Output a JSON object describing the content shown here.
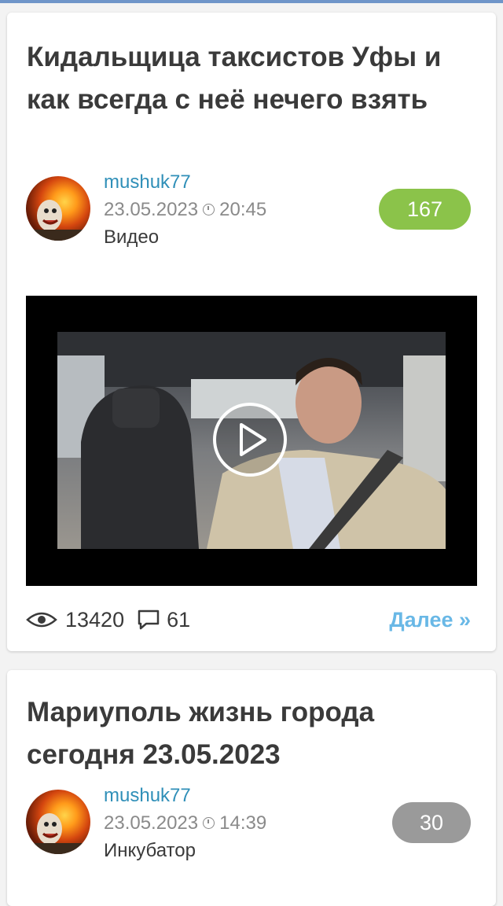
{
  "posts": [
    {
      "title": "Кидальщица таксистов Уфы и как всегда с неё нечего взять",
      "author": "mushuk77",
      "date": "23.05.2023",
      "time": "20:45",
      "category": "Видео",
      "rating": "167",
      "rating_color": "#8bc34a",
      "views": "13420",
      "comments": "61",
      "more_label": "Далее »"
    },
    {
      "title": "Мариуполь жизнь города сегодня 23.05.2023",
      "author": "mushuk77",
      "date": "23.05.2023",
      "time": "14:39",
      "category": "Инкубатор",
      "rating": "30",
      "rating_color": "#9a9a9a"
    }
  ],
  "icons": {
    "views": "eye-icon",
    "comments": "comment-icon",
    "time": "clock-icon",
    "play": "play-icon"
  },
  "colors": {
    "author": "#2f8fb8",
    "link": "#69b8e6",
    "topbar": "#6f95c9"
  }
}
